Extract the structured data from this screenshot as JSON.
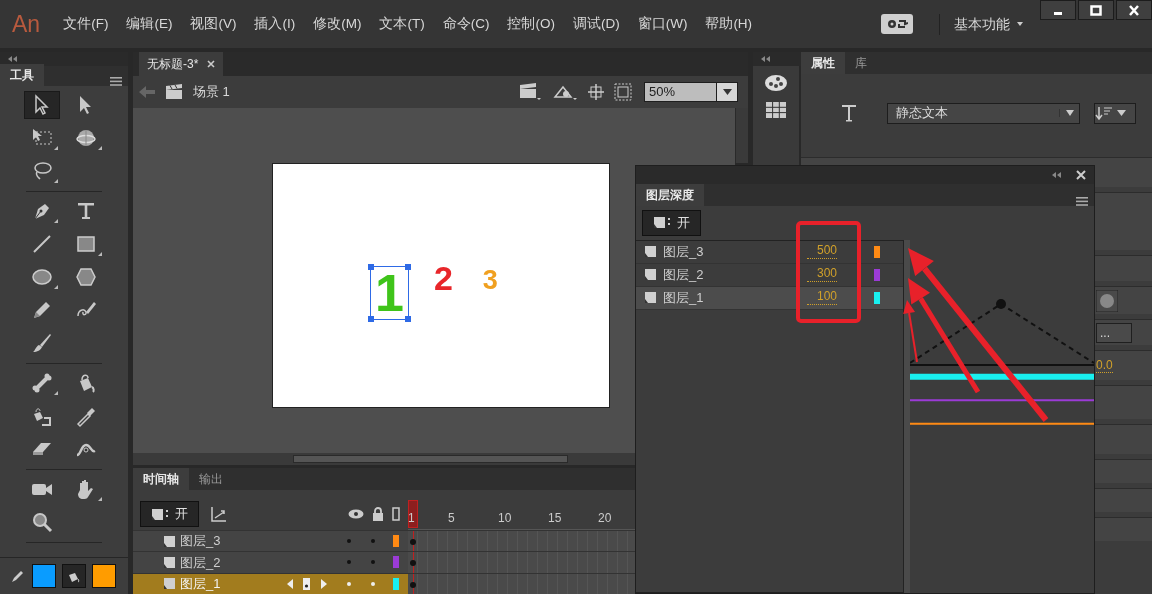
{
  "app": {
    "logo": "An"
  },
  "menu": [
    "文件(F)",
    "编辑(E)",
    "视图(V)",
    "插入(I)",
    "修改(M)",
    "文本(T)",
    "命令(C)",
    "控制(O)",
    "调试(D)",
    "窗口(W)",
    "帮助(H)"
  ],
  "workspace": {
    "label": "基本功能"
  },
  "tools_panel": {
    "title": "工具",
    "groups": [
      [
        {
          "kind": "selection",
          "selected": true,
          "flyout": false
        },
        {
          "kind": "subselection",
          "selected": false,
          "flyout": false
        },
        {
          "kind": "free-transform",
          "selected": false,
          "flyout": true
        },
        {
          "kind": "rotation-3d",
          "selected": false,
          "flyout": true
        },
        {
          "kind": "lasso",
          "selected": false,
          "flyout": true
        }
      ],
      [
        {
          "kind": "pen",
          "selected": false,
          "flyout": true
        },
        {
          "kind": "text",
          "selected": false,
          "flyout": false
        },
        {
          "kind": "line",
          "selected": false,
          "flyout": false
        },
        {
          "kind": "rectangle",
          "selected": false,
          "flyout": true
        },
        {
          "kind": "oval",
          "selected": false,
          "flyout": true
        },
        {
          "kind": "polystar",
          "selected": false,
          "flyout": false
        },
        {
          "kind": "pencil",
          "selected": false,
          "flyout": false
        },
        {
          "kind": "paint-brush",
          "selected": false,
          "flyout": false
        },
        {
          "kind": "brush",
          "selected": false,
          "flyout": false
        }
      ],
      [
        {
          "kind": "bone",
          "selected": false,
          "flyout": true
        },
        {
          "kind": "paint-bucket",
          "selected": false,
          "flyout": false
        },
        {
          "kind": "ink-bottle",
          "selected": false,
          "flyout": false
        },
        {
          "kind": "eyedropper",
          "selected": false,
          "flyout": false
        },
        {
          "kind": "eraser",
          "selected": false,
          "flyout": false
        },
        {
          "kind": "width",
          "selected": false,
          "flyout": false
        }
      ],
      [
        {
          "kind": "camera",
          "selected": false,
          "flyout": false
        },
        {
          "kind": "hand",
          "selected": false,
          "flyout": true
        },
        {
          "kind": "zoom",
          "selected": false,
          "flyout": false
        }
      ]
    ],
    "swatches": [
      {
        "kind": "stroke",
        "color": "#0a9cff"
      },
      {
        "kind": "fill",
        "color": "#ff9c00"
      }
    ]
  },
  "document": {
    "tabs": [
      {
        "label": "无标题-3*",
        "selected": true
      }
    ],
    "scene": "场景 1",
    "zoom": "50%",
    "stage_items": [
      {
        "text": "1",
        "color": "#3fc41a",
        "selected": true
      },
      {
        "text": "2",
        "color": "#e8262a",
        "selected": false
      },
      {
        "text": "3",
        "color": "#f0a020",
        "selected": false
      }
    ]
  },
  "timeline": {
    "tabs": [
      {
        "label": "时间轴",
        "selected": true
      },
      {
        "label": "输出",
        "selected": false
      }
    ],
    "toggle": "开",
    "frame_numbers": [
      "1",
      "5",
      "10",
      "15",
      "20"
    ],
    "layers": [
      {
        "name": "图层_3",
        "color": "#ff8a14",
        "selected": false
      },
      {
        "name": "图层_2",
        "color": "#9b3bd6",
        "selected": false
      },
      {
        "name": "图层_1",
        "color": "#19f0f0",
        "selected": true
      }
    ]
  },
  "properties": {
    "tabs": [
      {
        "label": "属性",
        "selected": true
      },
      {
        "label": "库",
        "selected": false
      }
    ],
    "text_type": "静态文本",
    "partial_button": "...",
    "partial_value": "0.0"
  },
  "layer_depth_panel": {
    "title": "图层深度",
    "toggle": "开",
    "layers": [
      {
        "name": "图层_3",
        "depth": "500",
        "color": "#ff8a14",
        "selected": false
      },
      {
        "name": "图层_2",
        "depth": "300",
        "color": "#9b3bd6",
        "selected": false
      },
      {
        "name": "图层_1",
        "depth": "100",
        "color": "#19f0f0",
        "selected": true
      }
    ]
  }
}
